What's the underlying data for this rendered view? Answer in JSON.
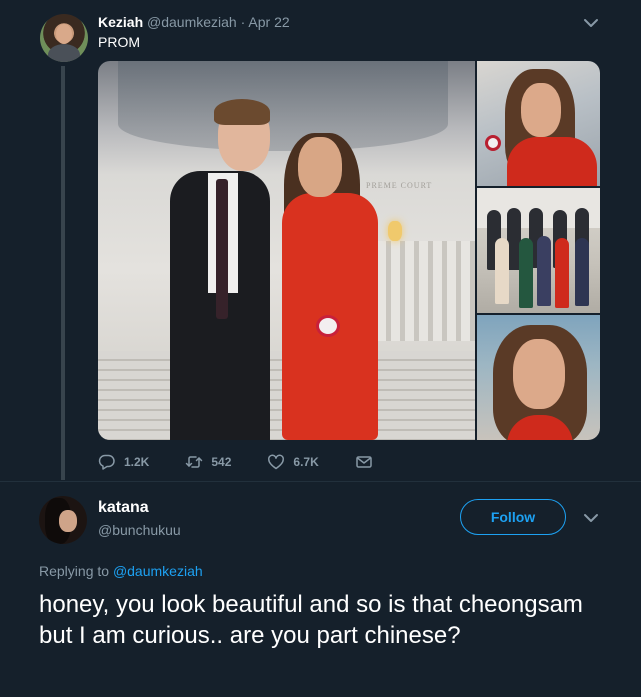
{
  "parent_tweet": {
    "display_name": "Keziah",
    "handle": "@daumkeziah",
    "separator": "·",
    "date": "Apr 22",
    "text": "PROM",
    "main_photo_wall_text": "PREME COURT",
    "actions": {
      "replies": "1.2K",
      "retweets": "542",
      "likes": "6.7K"
    }
  },
  "reply_tweet": {
    "display_name": "katana",
    "handle": "@bunchukuu",
    "follow_label": "Follow",
    "replying_prefix": "Replying to",
    "replying_handle": "@daumkeziah",
    "text": "honey, you look beautiful and so is that cheongsam but I am curious.. are you part chinese?"
  },
  "icons": {
    "reply": "reply-icon",
    "retweet": "retweet-icon",
    "like": "heart-icon",
    "dm": "envelope-icon",
    "more": "chevron-down-icon"
  },
  "colors": {
    "background": "#15202b",
    "accent": "#1da1f2",
    "muted": "#8899a6",
    "thread_line": "#38444d"
  }
}
